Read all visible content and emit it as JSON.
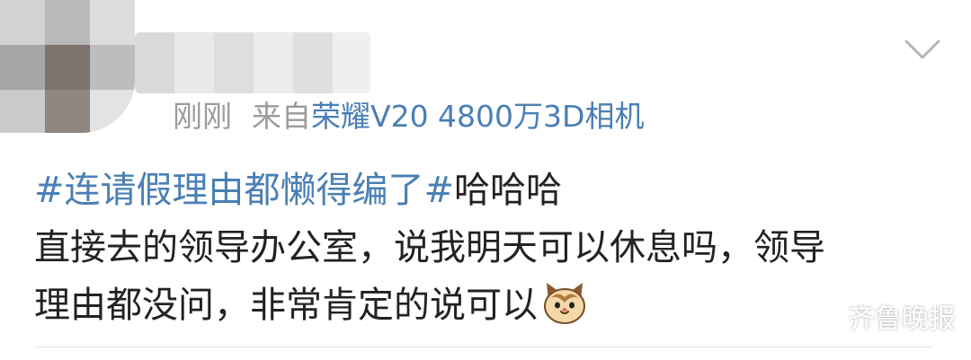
{
  "post": {
    "timestamp": "刚刚",
    "source_prefix": "来自",
    "source_device": "荣耀V20 4800万3D相机",
    "topic": "#连请假理由都懒得编了#",
    "text_after_topic": "哈哈哈",
    "line2": "直接去的领导办公室，说我明天可以休息吗，领导",
    "line3": "理由都没问，非常肯定的说可以",
    "emoji": "cat-face-emoji"
  },
  "watermark": {
    "text": "齐鲁晚报"
  },
  "colors": {
    "link": "#4a7fb5",
    "meta": "#9b9b9b",
    "text": "#222222"
  }
}
